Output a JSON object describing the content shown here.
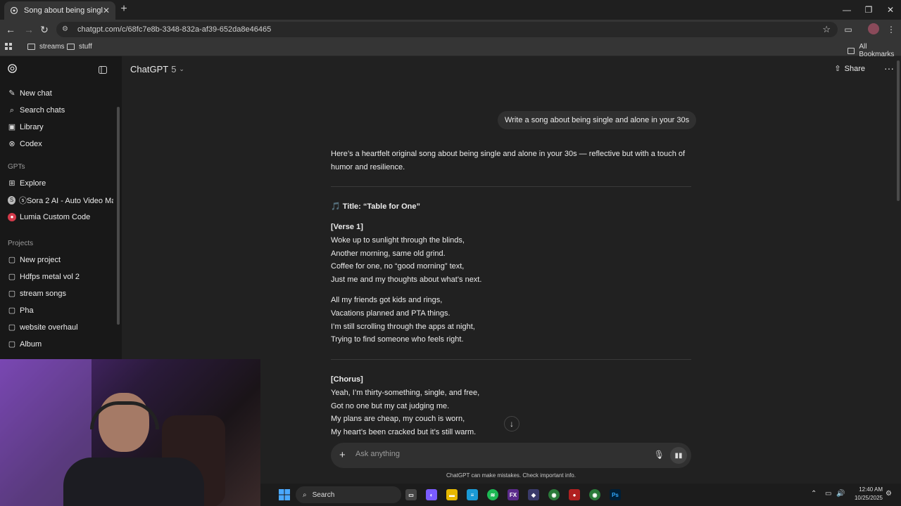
{
  "browser": {
    "tab_title": "Song about being single",
    "url": "chatgpt.com/c/68fc7e8b-3348-832a-af39-652da8e46465",
    "bookmarks": [
      "streams",
      "stuff"
    ],
    "all_bookmarks": "All Bookmarks"
  },
  "sidebar": {
    "top_items": [
      {
        "label": "New chat",
        "icon": "new-chat-icon"
      },
      {
        "label": "Search chats",
        "icon": "search-icon"
      },
      {
        "label": "Library",
        "icon": "library-icon"
      },
      {
        "label": "Codex",
        "icon": "codex-icon"
      }
    ],
    "gpts_header": "GPTs",
    "gpts": [
      {
        "label": "Explore",
        "icon": "grid-icon"
      },
      {
        "label": "ⓢSora 2 AI - Auto Video Ma...",
        "icon": "sora-icon"
      },
      {
        "label": "Lumia Custom Code",
        "icon": "lumia-icon"
      }
    ],
    "projects_header": "Projects",
    "projects": [
      "New project",
      "Hdfps metal vol 2",
      "stream songs",
      "Pha",
      "website overhaul",
      "Album"
    ]
  },
  "header": {
    "model": "ChatGPT",
    "version": "5",
    "share_label": "Share"
  },
  "chat": {
    "user_message": "Write a song about being single and alone in your 30s",
    "intro_line1": "Here’s a heartfelt original song about being single and alone in your 30s — reflective but with a touch of",
    "intro_line2": "humor and resilience.",
    "title_emoji": "🎵",
    "title": "Title: “Table for One”",
    "verse1_label": "[Verse 1]",
    "verse1": [
      "Woke up to sunlight through the blinds,",
      "Another morning, same old grind.",
      "Coffee for one, no “good morning” text,",
      "Just me and my thoughts about what’s next."
    ],
    "verse1b": [
      "All my friends got kids and rings,",
      "Vacations planned and PTA things.",
      "I’m still scrolling through the apps at night,",
      "Trying to find someone who feels right."
    ],
    "chorus_label": "[Chorus]",
    "chorus": [
      "Yeah, I’m thirty-something, single, and free,",
      "Got no one but my cat judging me.",
      "My plans are cheap, my couch is worn,",
      "My heart’s been cracked but it’s still warm."
    ]
  },
  "composer": {
    "placeholder": "Ask anything",
    "disclaimer": "ChatGPT can make mistakes. Check important info."
  },
  "taskbar": {
    "search": "Search",
    "time": "12:40 AM",
    "date": "10/25/2025"
  }
}
